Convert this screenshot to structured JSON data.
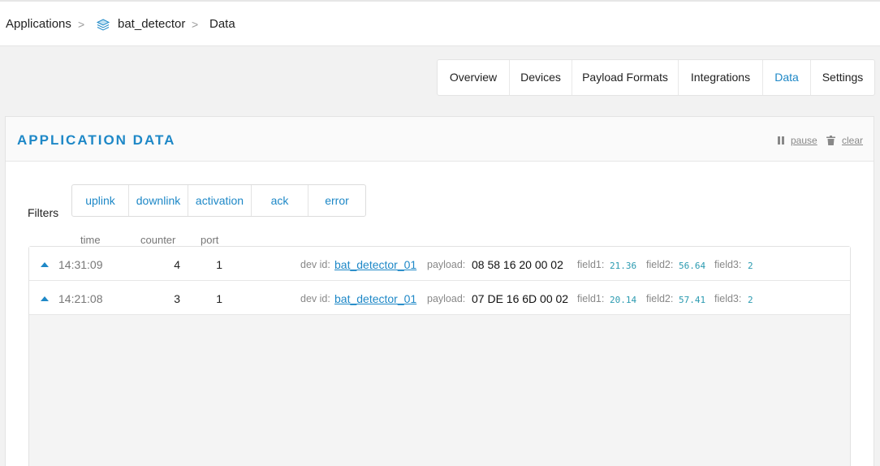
{
  "breadcrumb": {
    "applications": "Applications",
    "app": "bat_detector",
    "current": "Data",
    "separator": ">"
  },
  "tabs": [
    {
      "label": "Overview"
    },
    {
      "label": "Devices"
    },
    {
      "label": "Payload Formats"
    },
    {
      "label": "Integrations"
    },
    {
      "label": "Data",
      "active": true
    },
    {
      "label": "Settings"
    }
  ],
  "panel": {
    "title": "APPLICATION DATA",
    "pause_label": "pause",
    "clear_label": "clear"
  },
  "filters": {
    "label": "Filters",
    "items": [
      "uplink",
      "downlink",
      "activation",
      "ack",
      "error"
    ]
  },
  "columns": {
    "time": "time",
    "counter": "counter",
    "port": "port"
  },
  "rows": [
    {
      "time": "14:31:09",
      "counter": "4",
      "port": "1",
      "dev_id_label": "dev id:",
      "dev_id": "bat_detector_01",
      "payload_label": "payload:",
      "payload": "08 58 16 20 00 02",
      "field1_label": "field1:",
      "field1": "21.36",
      "field2_label": "field2:",
      "field2": "56.64",
      "field3_label": "field3:",
      "field3": "2"
    },
    {
      "time": "14:21:08",
      "counter": "3",
      "port": "1",
      "dev_id_label": "dev id:",
      "dev_id": "bat_detector_01",
      "payload_label": "payload:",
      "payload": "07 DE 16 6D 00 02",
      "field1_label": "field1:",
      "field1": "20.14",
      "field2_label": "field2:",
      "field2": "57.41",
      "field3_label": "field3:",
      "field3": "2"
    }
  ],
  "colors": {
    "accent": "#1e88c7",
    "field_value": "#2a9ab0"
  },
  "icons": {
    "app": "layers-icon",
    "pause": "pause-icon",
    "clear": "trash-icon",
    "expand": "triangle-up-icon"
  }
}
